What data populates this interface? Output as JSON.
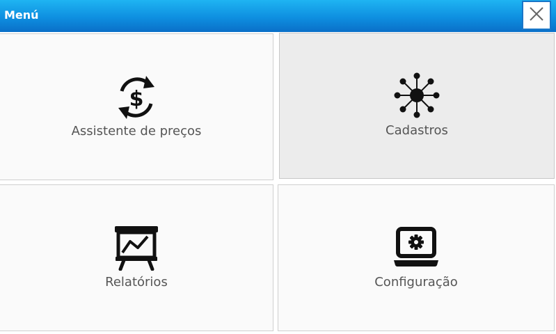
{
  "window": {
    "title": "Menú",
    "accent_color": "#0e8fe0",
    "close_icon": "close-icon"
  },
  "menu": {
    "items": [
      {
        "label": "Assistente de preços",
        "icon": "price-assistant-icon",
        "selected": false
      },
      {
        "label": "Cadastros",
        "icon": "network-hub-icon",
        "selected": true
      },
      {
        "label": "Relatórios",
        "icon": "report-chart-icon",
        "selected": false
      },
      {
        "label": "Configuração",
        "icon": "laptop-gear-icon",
        "selected": false
      }
    ]
  }
}
